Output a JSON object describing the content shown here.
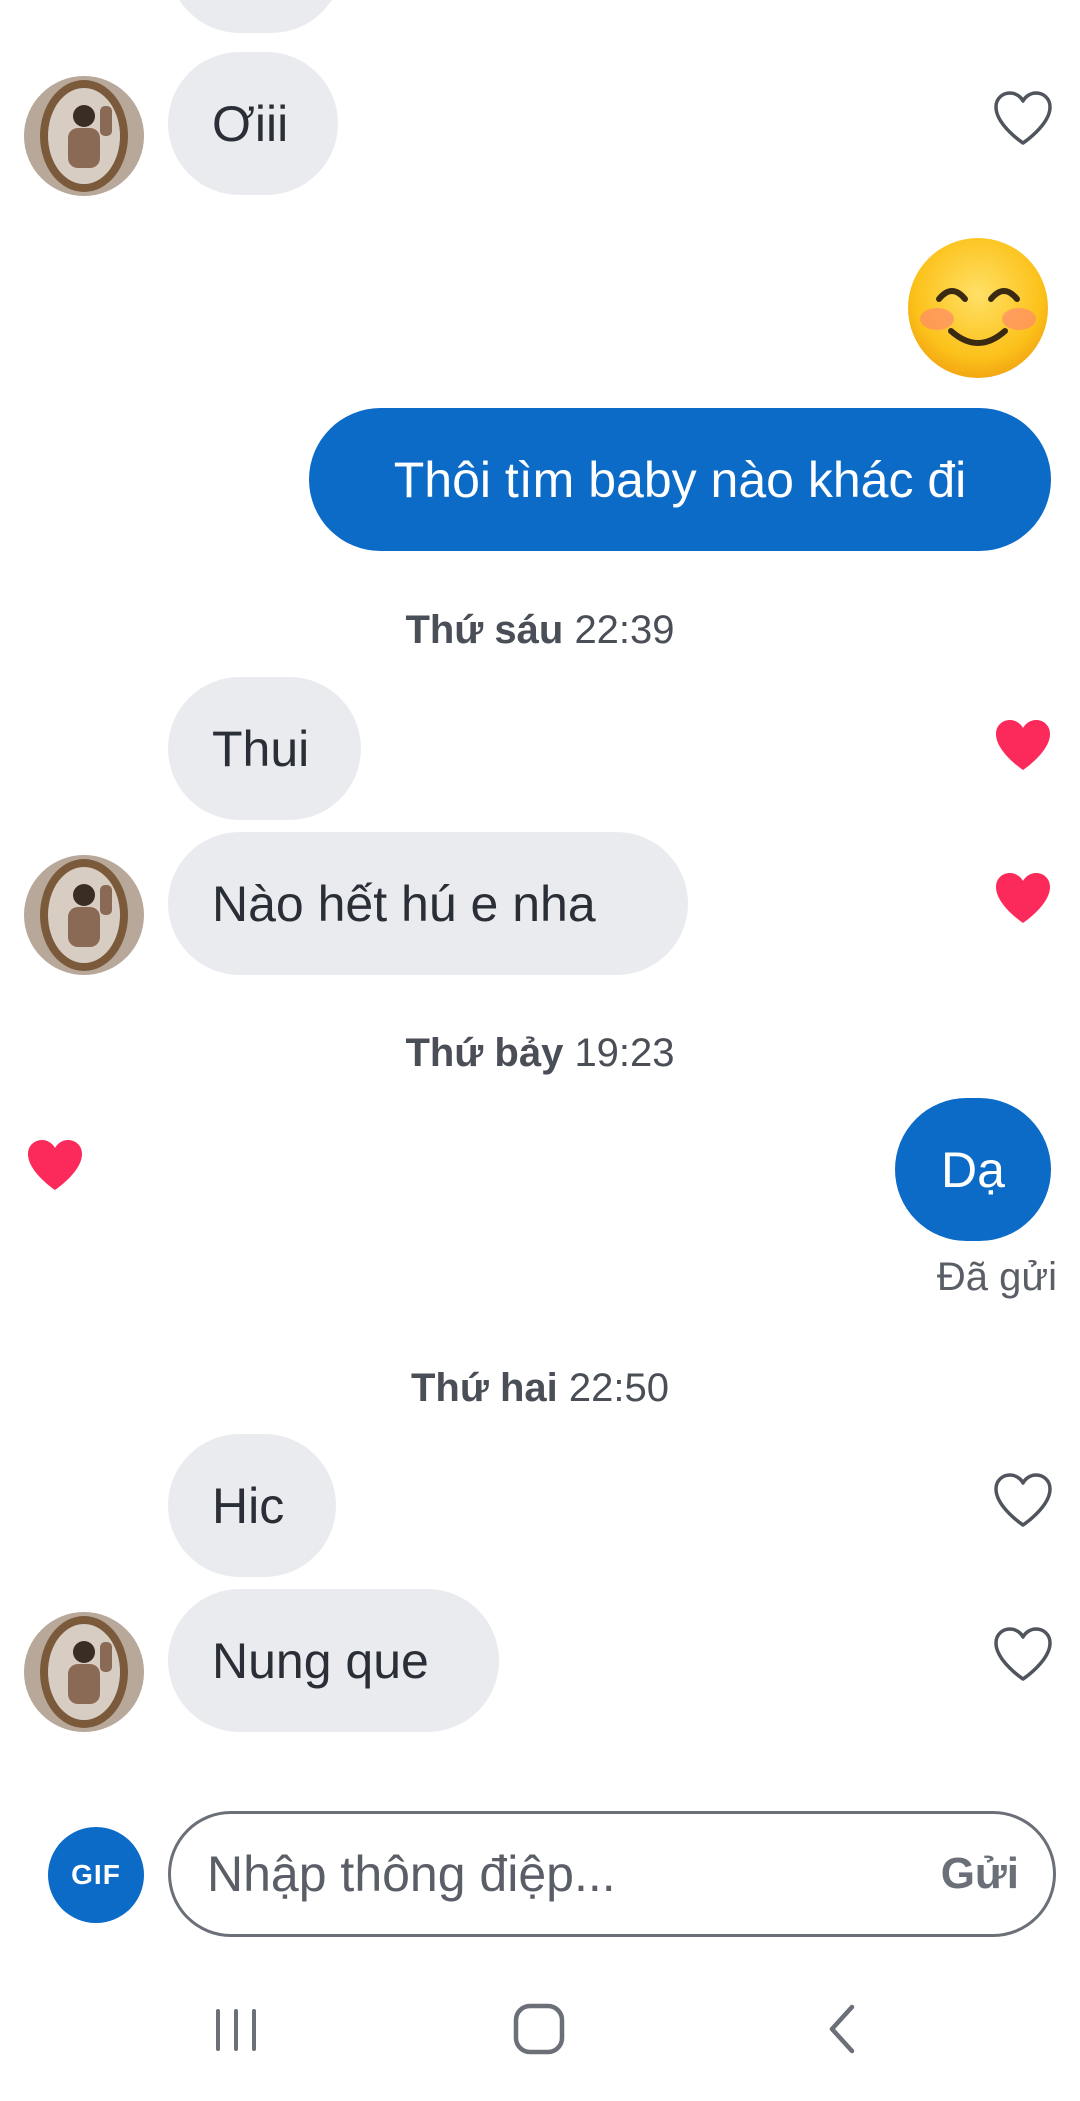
{
  "messages": {
    "m1": "Ơiii",
    "m2": "Thôi tìm baby nào khác đi",
    "m3": "Thui",
    "m4": "Nào hết hú e nha",
    "m5": "Dạ",
    "m6": "Hic",
    "m7": "Nung que"
  },
  "timestamps": {
    "t1": {
      "day": "Thứ sáu",
      "time": "22:39"
    },
    "t2": {
      "day": "Thứ bảy",
      "time": "19:23"
    },
    "t3": {
      "day": "Thứ hai",
      "time": "22:50"
    }
  },
  "status": {
    "sent": "Đã gửi"
  },
  "composer": {
    "gif_label": "GIF",
    "placeholder": "Nhập thông điệp...",
    "send_label": "Gửi"
  },
  "colors": {
    "accent": "#0b6bc7",
    "incoming_bubble": "#eaebef",
    "heart_liked": "#fc2a5a"
  },
  "icons": {
    "emoji": "smiling-face-with-smiling-eyes",
    "like": "heart-icon"
  }
}
